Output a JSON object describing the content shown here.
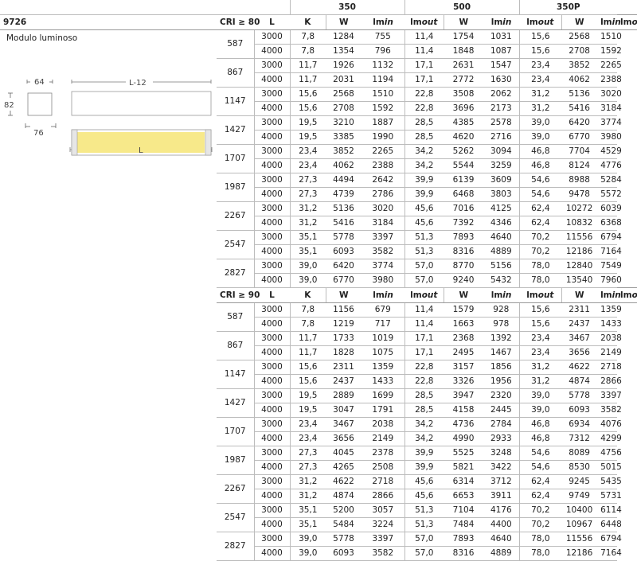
{
  "product_code": "9726",
  "description": "Modulo luminoso",
  "currents": [
    "350",
    "500",
    "350P"
  ],
  "cri80_label": "CRI ≥ 80",
  "cri90_label": "CRI ≥ 90",
  "col_L": "L",
  "col_K": "K",
  "col_W": "W",
  "col_lmin": "lm",
  "col_lmin_sub": "in",
  "col_lmout": "lm",
  "col_lmout_sub": "out",
  "diagram": {
    "dim_64": "64",
    "dim_L12": "L-12",
    "dim_82": "82",
    "dim_76": "76",
    "dim_L": "L"
  },
  "cri80_rows": [
    {
      "L": "587",
      "rows": [
        [
          "3000",
          "7,8",
          "1284",
          "755",
          "11,4",
          "1754",
          "1031",
          "15,6",
          "2568",
          "1510"
        ],
        [
          "4000",
          "7,8",
          "1354",
          "796",
          "11,4",
          "1848",
          "1087",
          "15,6",
          "2708",
          "1592"
        ]
      ]
    },
    {
      "L": "867",
      "rows": [
        [
          "3000",
          "11,7",
          "1926",
          "1132",
          "17,1",
          "2631",
          "1547",
          "23,4",
          "3852",
          "2265"
        ],
        [
          "4000",
          "11,7",
          "2031",
          "1194",
          "17,1",
          "2772",
          "1630",
          "23,4",
          "4062",
          "2388"
        ]
      ]
    },
    {
      "L": "1147",
      "rows": [
        [
          "3000",
          "15,6",
          "2568",
          "1510",
          "22,8",
          "3508",
          "2062",
          "31,2",
          "5136",
          "3020"
        ],
        [
          "4000",
          "15,6",
          "2708",
          "1592",
          "22,8",
          "3696",
          "2173",
          "31,2",
          "5416",
          "3184"
        ]
      ]
    },
    {
      "L": "1427",
      "rows": [
        [
          "3000",
          "19,5",
          "3210",
          "1887",
          "28,5",
          "4385",
          "2578",
          "39,0",
          "6420",
          "3774"
        ],
        [
          "4000",
          "19,5",
          "3385",
          "1990",
          "28,5",
          "4620",
          "2716",
          "39,0",
          "6770",
          "3980"
        ]
      ]
    },
    {
      "L": "1707",
      "rows": [
        [
          "3000",
          "23,4",
          "3852",
          "2265",
          "34,2",
          "5262",
          "3094",
          "46,8",
          "7704",
          "4529"
        ],
        [
          "4000",
          "23,4",
          "4062",
          "2388",
          "34,2",
          "5544",
          "3259",
          "46,8",
          "8124",
          "4776"
        ]
      ]
    },
    {
      "L": "1987",
      "rows": [
        [
          "3000",
          "27,3",
          "4494",
          "2642",
          "39,9",
          "6139",
          "3609",
          "54,6",
          "8988",
          "5284"
        ],
        [
          "4000",
          "27,3",
          "4739",
          "2786",
          "39,9",
          "6468",
          "3803",
          "54,6",
          "9478",
          "5572"
        ]
      ]
    },
    {
      "L": "2267",
      "rows": [
        [
          "3000",
          "31,2",
          "5136",
          "3020",
          "45,6",
          "7016",
          "4125",
          "62,4",
          "10272",
          "6039"
        ],
        [
          "4000",
          "31,2",
          "5416",
          "3184",
          "45,6",
          "7392",
          "4346",
          "62,4",
          "10832",
          "6368"
        ]
      ]
    },
    {
      "L": "2547",
      "rows": [
        [
          "3000",
          "35,1",
          "5778",
          "3397",
          "51,3",
          "7893",
          "4640",
          "70,2",
          "11556",
          "6794"
        ],
        [
          "4000",
          "35,1",
          "6093",
          "3582",
          "51,3",
          "8316",
          "4889",
          "70,2",
          "12186",
          "7164"
        ]
      ]
    },
    {
      "L": "2827",
      "rows": [
        [
          "3000",
          "39,0",
          "6420",
          "3774",
          "57,0",
          "8770",
          "5156",
          "78,0",
          "12840",
          "7549"
        ],
        [
          "4000",
          "39,0",
          "6770",
          "3980",
          "57,0",
          "9240",
          "5432",
          "78,0",
          "13540",
          "7960"
        ]
      ]
    }
  ],
  "cri90_rows": [
    {
      "L": "587",
      "rows": [
        [
          "3000",
          "7,8",
          "1156",
          "679",
          "11,4",
          "1579",
          "928",
          "15,6",
          "2311",
          "1359"
        ],
        [
          "4000",
          "7,8",
          "1219",
          "717",
          "11,4",
          "1663",
          "978",
          "15,6",
          "2437",
          "1433"
        ]
      ]
    },
    {
      "L": "867",
      "rows": [
        [
          "3000",
          "11,7",
          "1733",
          "1019",
          "17,1",
          "2368",
          "1392",
          "23,4",
          "3467",
          "2038"
        ],
        [
          "4000",
          "11,7",
          "1828",
          "1075",
          "17,1",
          "2495",
          "1467",
          "23,4",
          "3656",
          "2149"
        ]
      ]
    },
    {
      "L": "1147",
      "rows": [
        [
          "3000",
          "15,6",
          "2311",
          "1359",
          "22,8",
          "3157",
          "1856",
          "31,2",
          "4622",
          "2718"
        ],
        [
          "4000",
          "15,6",
          "2437",
          "1433",
          "22,8",
          "3326",
          "1956",
          "31,2",
          "4874",
          "2866"
        ]
      ]
    },
    {
      "L": "1427",
      "rows": [
        [
          "3000",
          "19,5",
          "2889",
          "1699",
          "28,5",
          "3947",
          "2320",
          "39,0",
          "5778",
          "3397"
        ],
        [
          "4000",
          "19,5",
          "3047",
          "1791",
          "28,5",
          "4158",
          "2445",
          "39,0",
          "6093",
          "3582"
        ]
      ]
    },
    {
      "L": "1707",
      "rows": [
        [
          "3000",
          "23,4",
          "3467",
          "2038",
          "34,2",
          "4736",
          "2784",
          "46,8",
          "6934",
          "4076"
        ],
        [
          "4000",
          "23,4",
          "3656",
          "2149",
          "34,2",
          "4990",
          "2933",
          "46,8",
          "7312",
          "4299"
        ]
      ]
    },
    {
      "L": "1987",
      "rows": [
        [
          "3000",
          "27,3",
          "4045",
          "2378",
          "39,9",
          "5525",
          "3248",
          "54,6",
          "8089",
          "4756"
        ],
        [
          "4000",
          "27,3",
          "4265",
          "2508",
          "39,9",
          "5821",
          "3422",
          "54,6",
          "8530",
          "5015"
        ]
      ]
    },
    {
      "L": "2267",
      "rows": [
        [
          "3000",
          "31,2",
          "4622",
          "2718",
          "45,6",
          "6314",
          "3712",
          "62,4",
          "9245",
          "5435"
        ],
        [
          "4000",
          "31,2",
          "4874",
          "2866",
          "45,6",
          "6653",
          "3911",
          "62,4",
          "9749",
          "5731"
        ]
      ]
    },
    {
      "L": "2547",
      "rows": [
        [
          "3000",
          "35,1",
          "5200",
          "3057",
          "51,3",
          "7104",
          "4176",
          "70,2",
          "10400",
          "6114"
        ],
        [
          "4000",
          "35,1",
          "5484",
          "3224",
          "51,3",
          "7484",
          "4400",
          "70,2",
          "10967",
          "6448"
        ]
      ]
    },
    {
      "L": "2827",
      "rows": [
        [
          "3000",
          "39,0",
          "5778",
          "3397",
          "57,0",
          "7893",
          "4640",
          "78,0",
          "11556",
          "6794"
        ],
        [
          "4000",
          "39,0",
          "6093",
          "3582",
          "57,0",
          "8316",
          "4889",
          "78,0",
          "12186",
          "7164"
        ]
      ]
    }
  ]
}
